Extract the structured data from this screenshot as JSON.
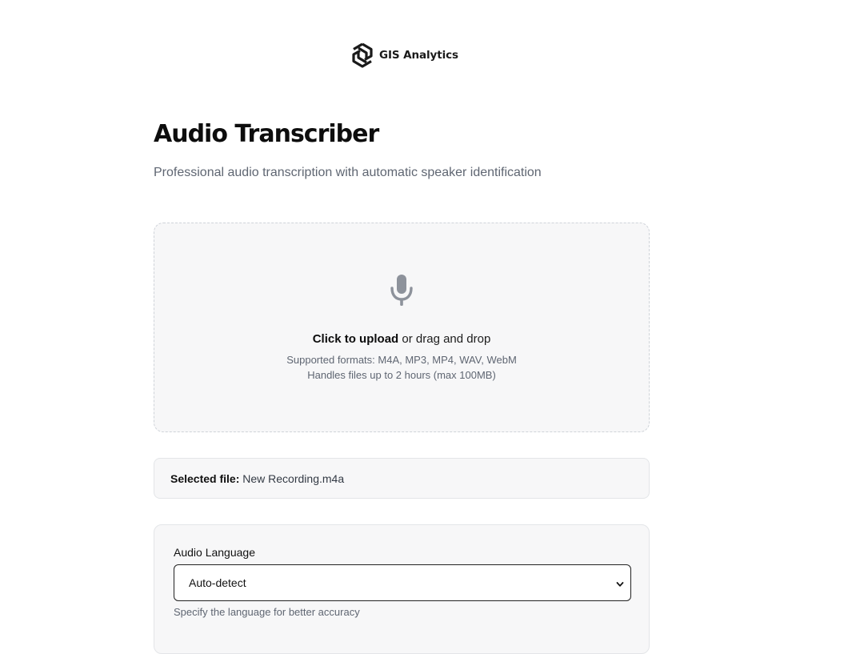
{
  "brand": {
    "name": "GIS Analytics",
    "logo_icon": "hexagon-swirl-logo"
  },
  "header": {
    "title": "Audio Transcriber",
    "subtitle": "Professional audio transcription with automatic speaker identification"
  },
  "dropzone": {
    "icon": "microphone-icon",
    "cta_strong": "Click to upload",
    "cta_rest": " or drag and drop",
    "formats": "Supported formats: M4A, MP3, MP4, WAV, WebM",
    "limit": "Handles files up to 2 hours (max 100MB)"
  },
  "selected_file": {
    "label": "Selected file:",
    "name": "New Recording.m4a"
  },
  "language": {
    "label": "Audio Language",
    "selected": "Auto-detect",
    "help": "Specify the language for better accuracy"
  },
  "colors": {
    "muted_text": "#5f6672",
    "icon_gray": "#8d929b",
    "card_bg": "#f7f7f8"
  }
}
